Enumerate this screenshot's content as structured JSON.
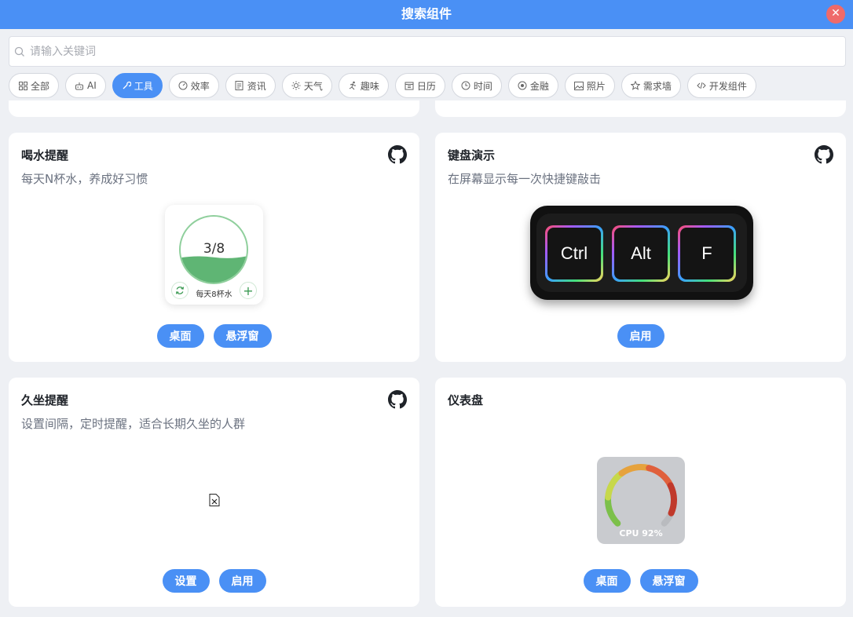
{
  "window": {
    "title": "搜索组件",
    "close_icon": "close-icon"
  },
  "search": {
    "placeholder": "请输入关键词",
    "value": ""
  },
  "tabs": [
    {
      "label": "全部",
      "icon": "grid-icon",
      "active": false
    },
    {
      "label": "AI",
      "icon": "robot-icon",
      "active": false
    },
    {
      "label": "工具",
      "icon": "wrench-icon",
      "active": true
    },
    {
      "label": "效率",
      "icon": "gauge-icon",
      "active": false
    },
    {
      "label": "资讯",
      "icon": "news-icon",
      "active": false
    },
    {
      "label": "天气",
      "icon": "sun-icon",
      "active": false
    },
    {
      "label": "趣味",
      "icon": "run-icon",
      "active": false
    },
    {
      "label": "日历",
      "icon": "calendar-icon",
      "active": false
    },
    {
      "label": "时间",
      "icon": "clock-icon",
      "active": false
    },
    {
      "label": "金融",
      "icon": "coin-icon",
      "active": false
    },
    {
      "label": "照片",
      "icon": "image-icon",
      "active": false
    },
    {
      "label": "需求墙",
      "icon": "star-icon",
      "active": false
    },
    {
      "label": "开发组件",
      "icon": "code-icon",
      "active": false
    }
  ],
  "cards": {
    "water": {
      "title": "喝水提醒",
      "desc": "每天N杯水，养成好习惯",
      "widget": {
        "count": "3/8",
        "subtitle": "每天8杯水",
        "progress": 0.375
      },
      "buttons": [
        "桌面",
        "悬浮窗"
      ]
    },
    "keyboard": {
      "title": "键盘演示",
      "desc": "在屏幕显示每一次快捷键敲击",
      "keys": [
        "Ctrl",
        "Alt",
        "F"
      ],
      "buttons": [
        "启用"
      ]
    },
    "sitting": {
      "title": "久坐提醒",
      "desc": "设置间隔，定时提醒，适合长期久坐的人群",
      "buttons": [
        "设置",
        "启用"
      ]
    },
    "dashboard": {
      "title": "仪表盘",
      "desc": "",
      "widget": {
        "label": "CPU 92%",
        "value": 0.92
      },
      "buttons": [
        "桌面",
        "悬浮窗"
      ]
    }
  },
  "colors": {
    "accent": "#4a90f5",
    "close": "#ef6a6a",
    "water": "#5fb574"
  }
}
